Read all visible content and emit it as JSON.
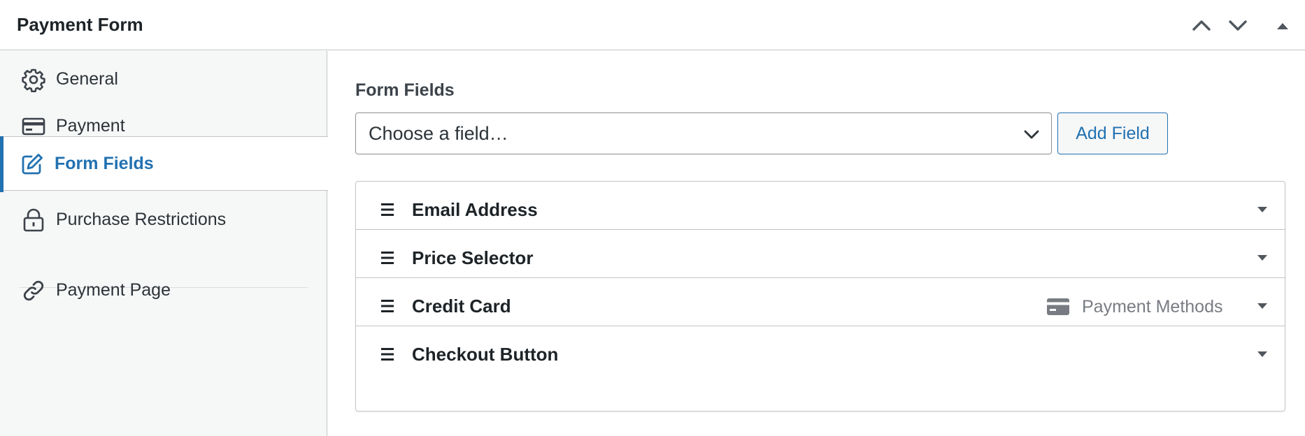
{
  "header": {
    "title": "Payment Form",
    "icons": [
      "chevron-up-icon",
      "chevron-down-icon",
      "triangle-up-icon"
    ]
  },
  "sidebar": {
    "items": [
      {
        "label": "General",
        "icon": "gear-icon"
      },
      {
        "label": "Payment",
        "icon": "credit-card-icon"
      },
      {
        "label": "Form Fields",
        "icon": "edit-icon",
        "active": true
      },
      {
        "label": "Purchase Restrictions",
        "icon": "lock-icon"
      },
      {
        "label": "Payment Page",
        "icon": "link-icon"
      }
    ]
  },
  "main": {
    "section_title": "Form Fields",
    "field_select": {
      "value": "Choose a field…"
    },
    "add_button": "Add Field",
    "fields": [
      {
        "label": "Email Address"
      },
      {
        "label": "Price Selector"
      },
      {
        "label": "Credit Card",
        "meta": "Payment Methods",
        "meta_icon": "credit-card-icon"
      },
      {
        "label": "Checkout Button"
      }
    ]
  },
  "colors": {
    "accent": "#2271b1",
    "border": "#c3c4c7",
    "sidebar_bg": "#f6f7f7",
    "muted_text": "#787c82"
  }
}
